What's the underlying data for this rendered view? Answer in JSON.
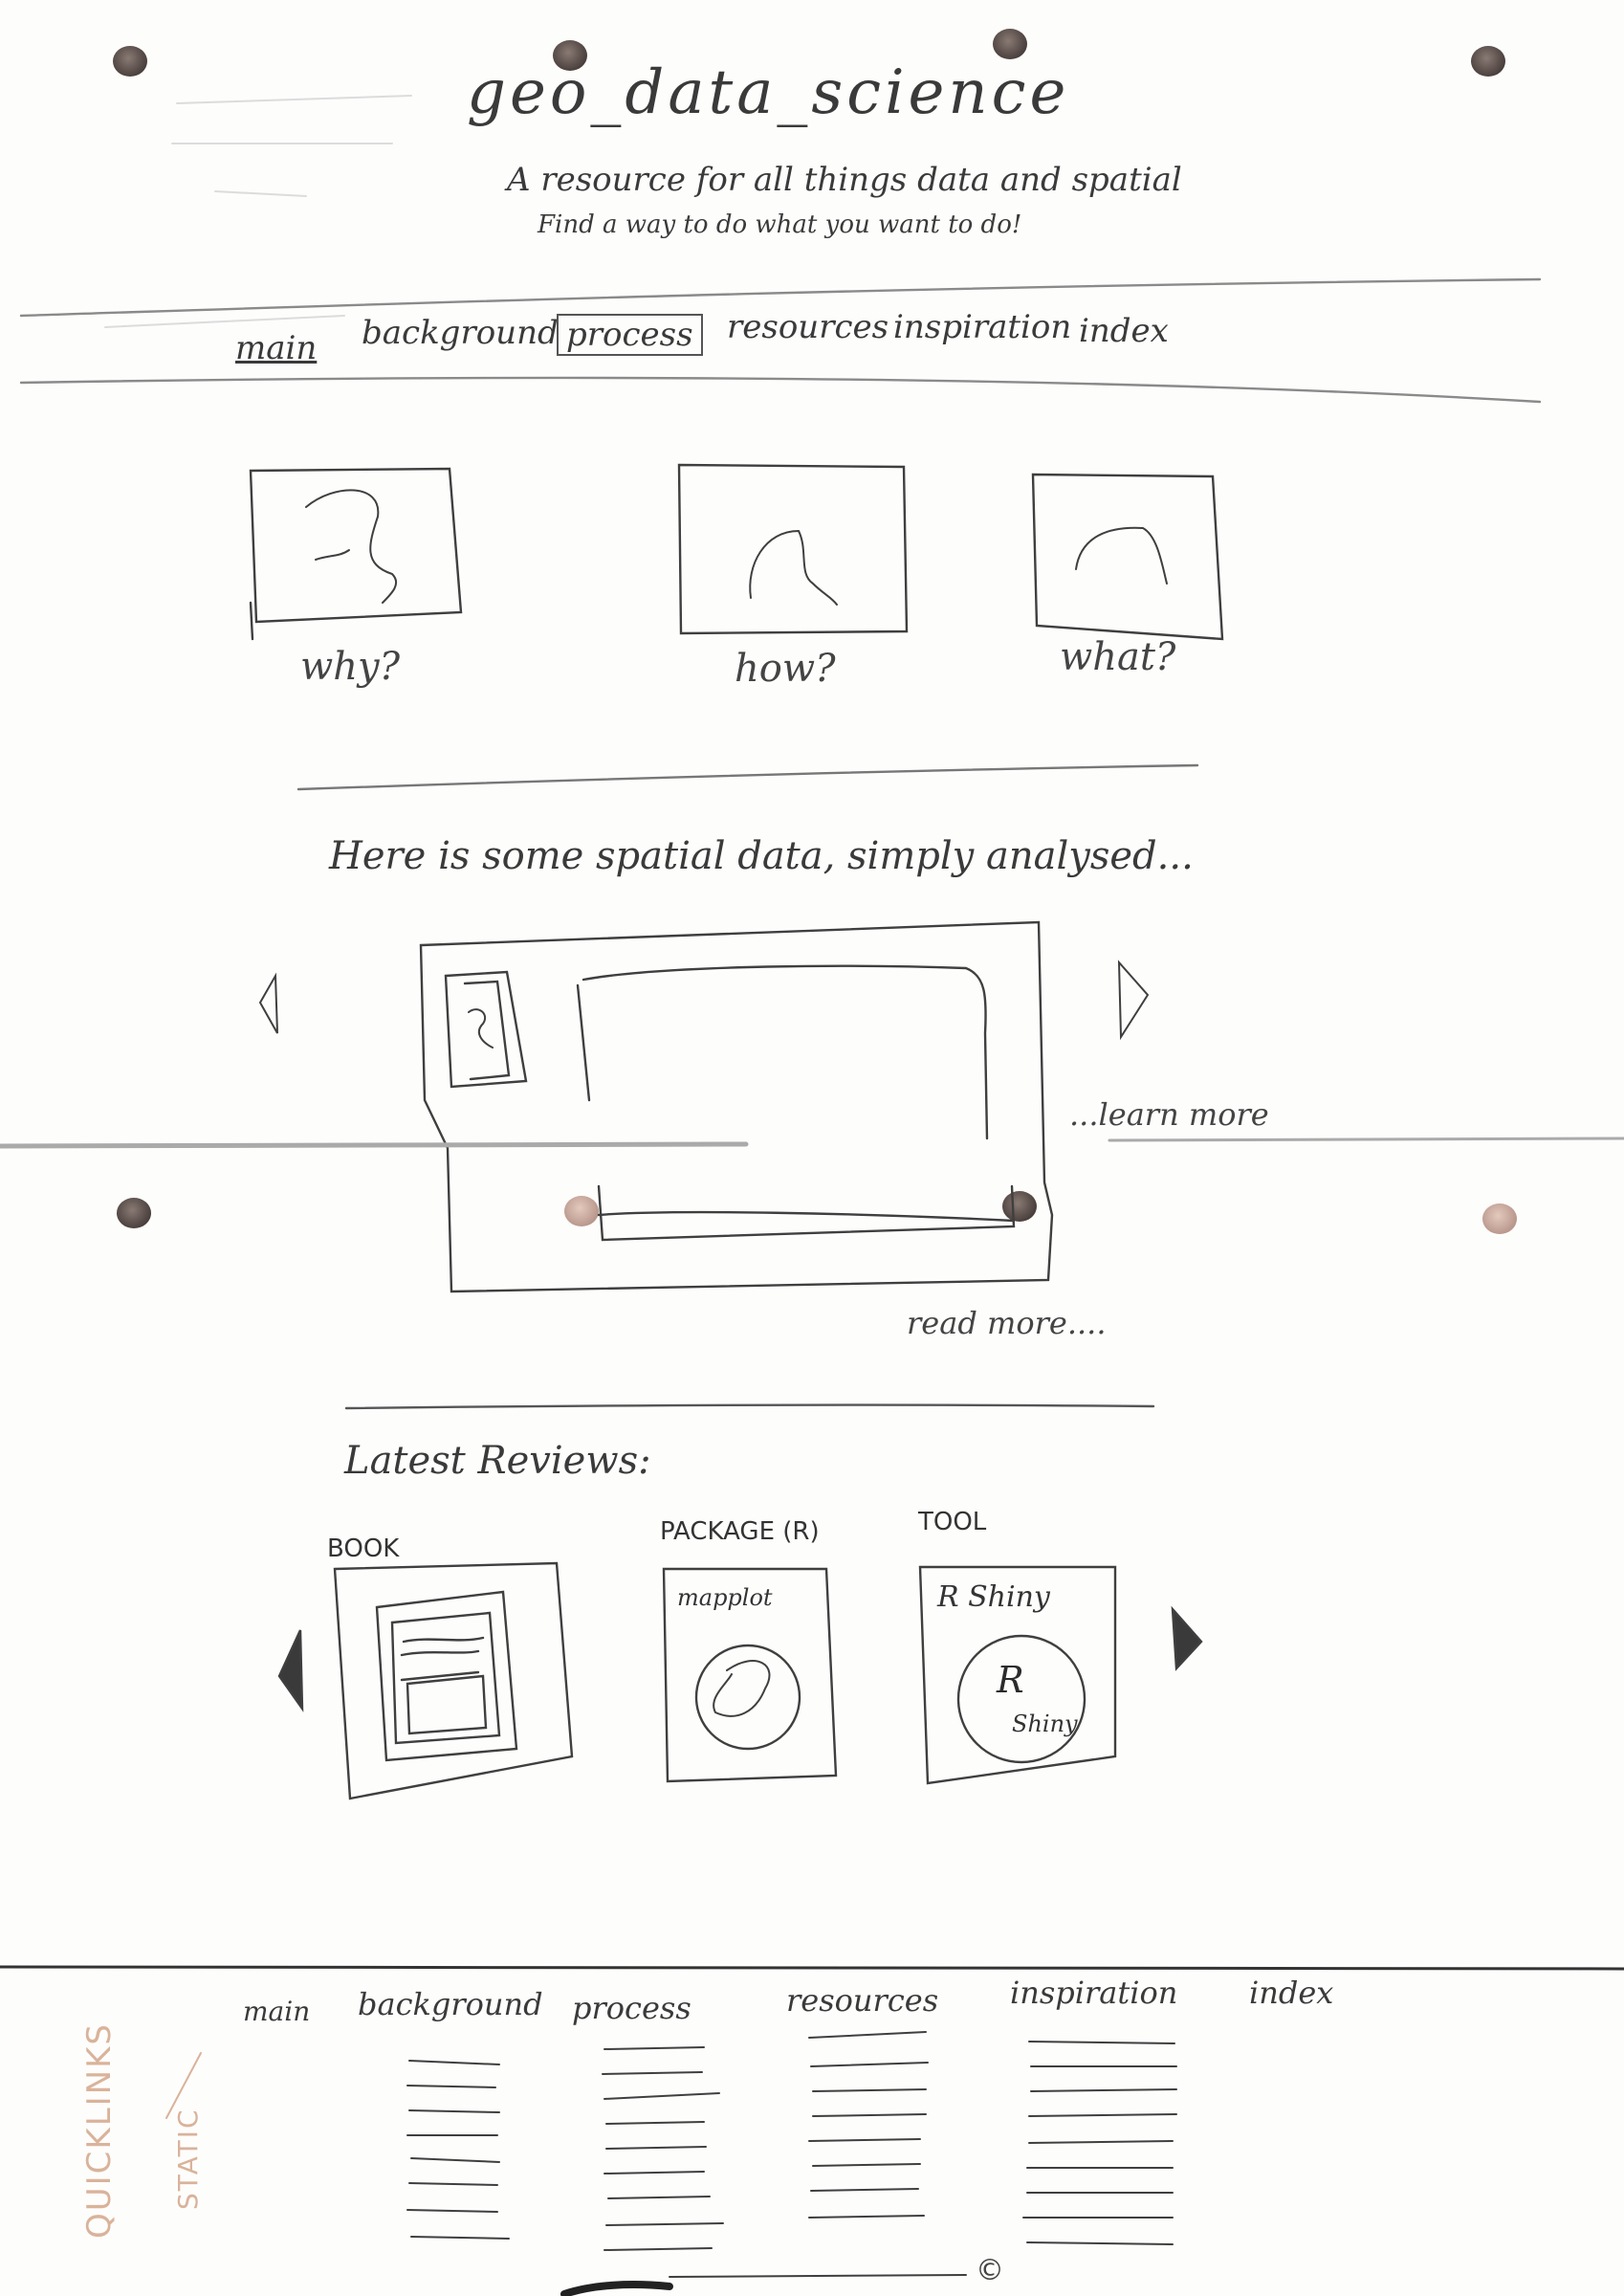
{
  "header": {
    "title": "geo_data_science",
    "tagline": "A resource for all things data and spatial",
    "subtagline": "Find a way to do what you want to do!"
  },
  "nav": {
    "items": [
      {
        "label": "main"
      },
      {
        "label": "background"
      },
      {
        "label": "process"
      },
      {
        "label": "resources"
      },
      {
        "label": "inspiration"
      },
      {
        "label": "index"
      }
    ]
  },
  "intro_cards": [
    {
      "caption": "why?"
    },
    {
      "caption": "how?"
    },
    {
      "caption": "what?"
    }
  ],
  "spatial_section": {
    "heading": "Here is some spatial data, simply analysed...",
    "learn_more": "...learn more",
    "read_more": "read more...."
  },
  "reviews": {
    "heading": "Latest Reviews:",
    "items": [
      {
        "category": "BOOK",
        "label": ""
      },
      {
        "category": "PACKAGE (R)",
        "label": "mapplot"
      },
      {
        "category": "TOOL",
        "label": "R Shiny",
        "logo_letter": "R",
        "logo_sub": "Shiny"
      }
    ]
  },
  "footer": {
    "columns": [
      {
        "label": "main"
      },
      {
        "label": "background"
      },
      {
        "label": "process"
      },
      {
        "label": "resources"
      },
      {
        "label": "inspiration"
      },
      {
        "label": "index"
      }
    ],
    "quicklinks": "QUICKLINKS",
    "static": "STATIC",
    "copyright": "©"
  }
}
